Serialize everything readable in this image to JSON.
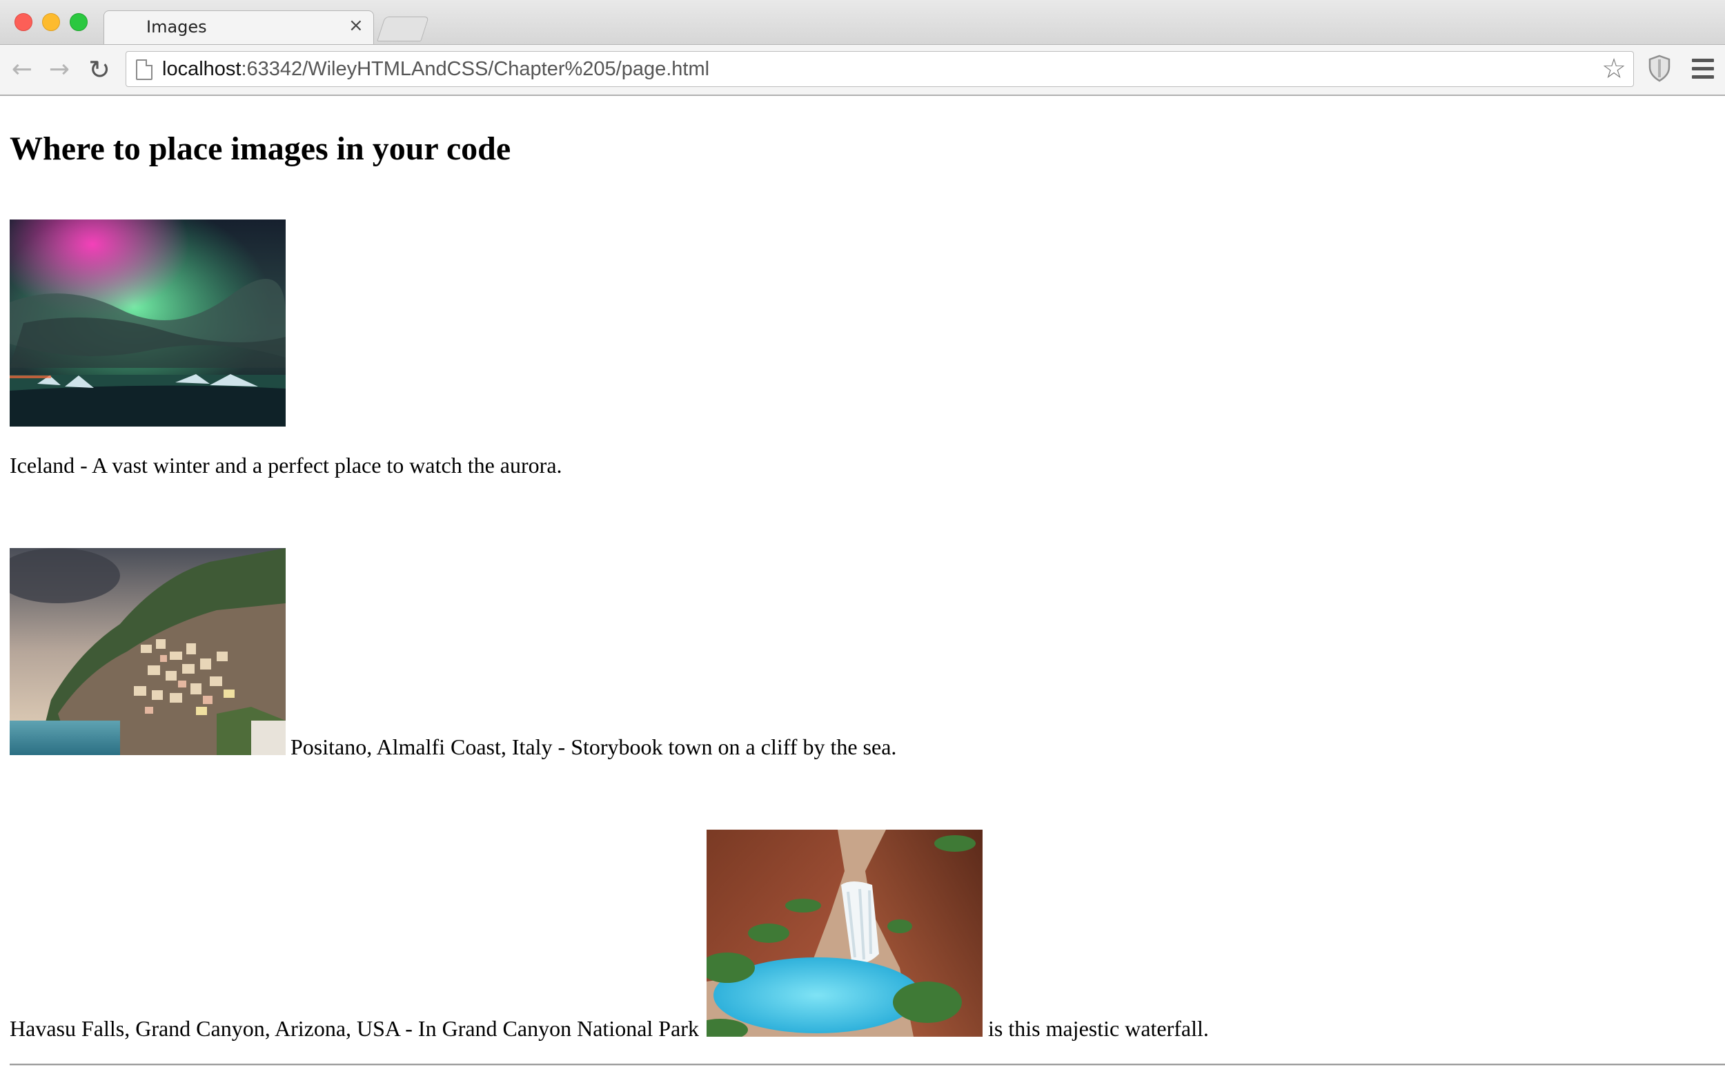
{
  "browser": {
    "tab_title": "Images",
    "tab_close": "×",
    "url_host": "localhost",
    "url_rest": ":63342/WileyHTMLAndCSS/Chapter%205/page.html",
    "icons": [
      "back-arrow-icon",
      "forward-arrow-icon",
      "reload-icon",
      "page-icon",
      "star-icon",
      "shield-icon",
      "menu-icon"
    ],
    "glyphs": {
      "back": "←",
      "forward": "→",
      "reload": "↻",
      "star": "☆"
    },
    "colors": {
      "close": "#fc5f57",
      "minimize": "#fdbb2e",
      "maximize": "#2bc840"
    }
  },
  "page": {
    "heading": "Where to place images in your code",
    "iceland_caption": "Iceland - A vast winter and a perfect place to watch the aurora.",
    "positano_caption": "Positano, Almalfi Coast, Italy - Storybook town on a cliff by the sea.",
    "havasu_caption_before": "Havasu Falls, Grand Canyon, Arizona, USA - In Grand Canyon National Park",
    "havasu_caption_after": "is this majestic waterfall."
  }
}
